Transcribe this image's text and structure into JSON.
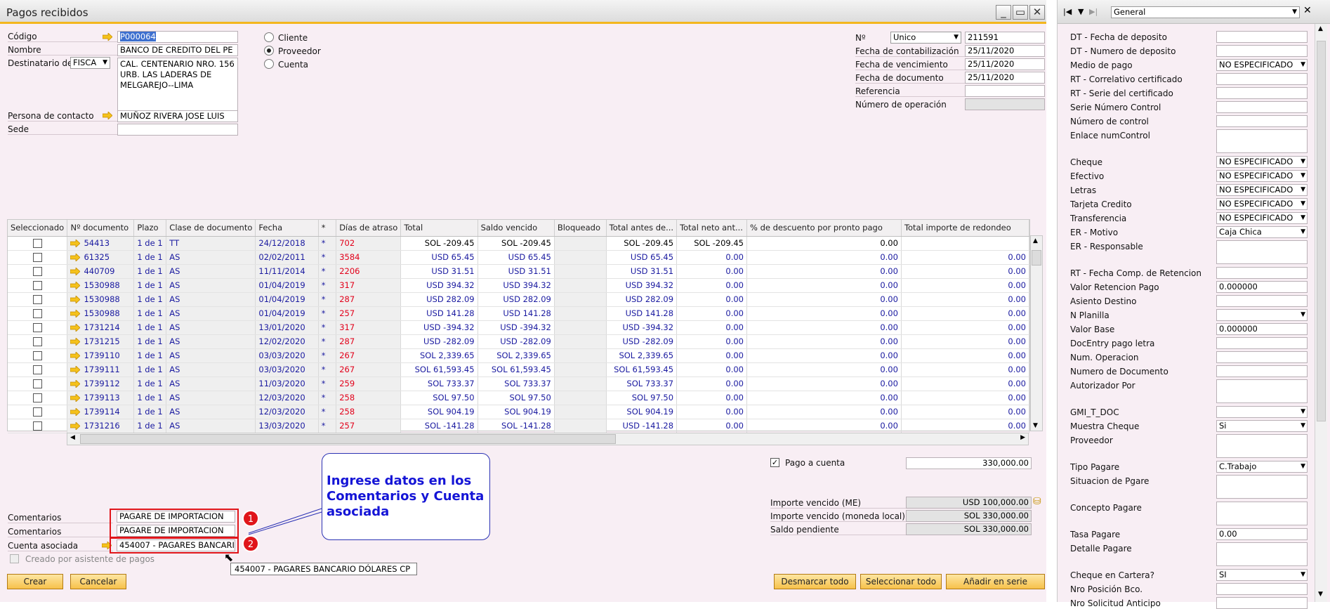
{
  "window": {
    "title": "Pagos recibidos"
  },
  "header": {
    "codigo_label": "Código",
    "codigo_value": "P000064",
    "nombre_label": "Nombre",
    "nombre_value": "BANCO DE CREDITO DEL PE",
    "destinatario_label": "Destinatario de f",
    "destinatario_select": "FISCA",
    "address_lines": [
      "CAL. CENTENARIO NRO. 156",
      "URB. LAS LADERAS DE",
      "MELGAREJO--LIMA"
    ],
    "persona_label": "Persona de contacto",
    "persona_value": "MUÑOZ RIVERA JOSE LUIS",
    "sede_label": "Sede",
    "radio_cliente": "Cliente",
    "radio_proveedor": "Proveedor",
    "radio_cuenta": "Cuenta",
    "no_label": "Nº",
    "no_select": "Unico",
    "no_value": "211591",
    "fecha_contab_label": "Fecha de contabilización",
    "fecha_contab_value": "25/11/2020",
    "fecha_venc_label": "Fecha de vencimiento",
    "fecha_venc_value": "25/11/2020",
    "fecha_doc_label": "Fecha de documento",
    "fecha_doc_value": "25/11/2020",
    "referencia_label": "Referencia",
    "num_oper_label": "Número de operación"
  },
  "grid": {
    "columns": [
      "Seleccionado",
      "Nº documento",
      "Plazo",
      "Clase de documento",
      "Fecha",
      "*",
      "Días de atraso",
      "Total",
      "Saldo vencido",
      "Bloqueado",
      "Total antes de...",
      "Total neto ant...",
      "% de descuento por pronto pago",
      "Total importe de redondeo"
    ],
    "rows": [
      {
        "doc": "54413",
        "plazo": "1 de 1",
        "clase": "TT",
        "fecha": "24/12/2018",
        "star": "*",
        "dias": "702",
        "total": "SOL -209.45",
        "saldo": "SOL -209.45",
        "antes": "SOL -209.45",
        "neto": "SOL -209.45",
        "desc": "0.00",
        "redondeo": ""
      },
      {
        "doc": "61325",
        "plazo": "1 de 1",
        "clase": "AS",
        "fecha": "02/02/2011",
        "star": "*",
        "dias": "3584",
        "total": "USD 65.45",
        "saldo": "USD 65.45",
        "antes": "USD 65.45",
        "neto": "0.00",
        "desc": "0.00",
        "redondeo": "0.00"
      },
      {
        "doc": "440709",
        "plazo": "1 de 1",
        "clase": "AS",
        "fecha": "11/11/2014",
        "star": "*",
        "dias": "2206",
        "total": "USD 31.51",
        "saldo": "USD 31.51",
        "antes": "USD 31.51",
        "neto": "0.00",
        "desc": "0.00",
        "redondeo": "0.00"
      },
      {
        "doc": "1530988",
        "plazo": "1 de 1",
        "clase": "AS",
        "fecha": "01/04/2019",
        "star": "*",
        "dias": "317",
        "total": "USD 394.32",
        "saldo": "USD 394.32",
        "antes": "USD 394.32",
        "neto": "0.00",
        "desc": "0.00",
        "redondeo": "0.00"
      },
      {
        "doc": "1530988",
        "plazo": "1 de 1",
        "clase": "AS",
        "fecha": "01/04/2019",
        "star": "*",
        "dias": "287",
        "total": "USD 282.09",
        "saldo": "USD 282.09",
        "antes": "USD 282.09",
        "neto": "0.00",
        "desc": "0.00",
        "redondeo": "0.00"
      },
      {
        "doc": "1530988",
        "plazo": "1 de 1",
        "clase": "AS",
        "fecha": "01/04/2019",
        "star": "*",
        "dias": "257",
        "total": "USD 141.28",
        "saldo": "USD 141.28",
        "antes": "USD 141.28",
        "neto": "0.00",
        "desc": "0.00",
        "redondeo": "0.00"
      },
      {
        "doc": "1731214",
        "plazo": "1 de 1",
        "clase": "AS",
        "fecha": "13/01/2020",
        "star": "*",
        "dias": "317",
        "total": "USD -394.32",
        "saldo": "USD -394.32",
        "antes": "USD -394.32",
        "neto": "0.00",
        "desc": "0.00",
        "redondeo": "0.00"
      },
      {
        "doc": "1731215",
        "plazo": "1 de 1",
        "clase": "AS",
        "fecha": "12/02/2020",
        "star": "*",
        "dias": "287",
        "total": "USD -282.09",
        "saldo": "USD -282.09",
        "antes": "USD -282.09",
        "neto": "0.00",
        "desc": "0.00",
        "redondeo": "0.00"
      },
      {
        "doc": "1739110",
        "plazo": "1 de 1",
        "clase": "AS",
        "fecha": "03/03/2020",
        "star": "*",
        "dias": "267",
        "total": "SOL 2,339.65",
        "saldo": "SOL 2,339.65",
        "antes": "SOL 2,339.65",
        "neto": "0.00",
        "desc": "0.00",
        "redondeo": "0.00"
      },
      {
        "doc": "1739111",
        "plazo": "1 de 1",
        "clase": "AS",
        "fecha": "03/03/2020",
        "star": "*",
        "dias": "267",
        "total": "SOL 61,593.45",
        "saldo": "SOL 61,593.45",
        "antes": "SOL 61,593.45",
        "neto": "0.00",
        "desc": "0.00",
        "redondeo": "0.00"
      },
      {
        "doc": "1739112",
        "plazo": "1 de 1",
        "clase": "AS",
        "fecha": "11/03/2020",
        "star": "*",
        "dias": "259",
        "total": "SOL 733.37",
        "saldo": "SOL 733.37",
        "antes": "SOL 733.37",
        "neto": "0.00",
        "desc": "0.00",
        "redondeo": "0.00"
      },
      {
        "doc": "1739113",
        "plazo": "1 de 1",
        "clase": "AS",
        "fecha": "12/03/2020",
        "star": "*",
        "dias": "258",
        "total": "SOL 97.50",
        "saldo": "SOL 97.50",
        "antes": "SOL 97.50",
        "neto": "0.00",
        "desc": "0.00",
        "redondeo": "0.00"
      },
      {
        "doc": "1739114",
        "plazo": "1 de 1",
        "clase": "AS",
        "fecha": "12/03/2020",
        "star": "*",
        "dias": "258",
        "total": "SOL 904.19",
        "saldo": "SOL 904.19",
        "antes": "SOL 904.19",
        "neto": "0.00",
        "desc": "0.00",
        "redondeo": "0.00"
      },
      {
        "doc": "1731216",
        "plazo": "1 de 1",
        "clase": "AS",
        "fecha": "13/03/2020",
        "star": "*",
        "dias": "257",
        "total": "SOL -141.28",
        "saldo": "SOL -141.28",
        "antes": "USD -141.28",
        "neto": "0.00",
        "desc": "0.00",
        "redondeo": "0.00"
      }
    ]
  },
  "footer": {
    "pago_cuenta_label": "Pago a cuenta",
    "pago_cuenta_value": "330,000.00",
    "importe_me_label": "Importe vencido (ME)",
    "importe_me_value": "USD 100,000.00",
    "importe_ml_label": "Importe vencido (moneda local)",
    "importe_ml_value": "SOL 330,000.00",
    "saldo_label": "Saldo pendiente",
    "saldo_value": "SOL 330,000.00",
    "comentarios_label": "Comentarios",
    "comentarios1_value": "PAGARE DE IMPORTACION",
    "comentarios2_value": "PAGARE DE IMPORTACION",
    "cuenta_label": "Cuenta asociada",
    "cuenta_value": "454007 - PAGARES BANCARI",
    "asistente_label": "Creado por asistente de pagos",
    "tooltip": "454007 - PAGARES BANCARIO DÓLARES CP",
    "callout": "Ingrese datos en los Comentarios y Cuenta asociada",
    "badge1": "1",
    "badge2": "2",
    "btn_crear": "Crear",
    "btn_cancelar": "Cancelar",
    "btn_desmarcar": "Desmarcar todo",
    "btn_seleccionar": "Seleccionar todo",
    "btn_anadir": "Añadir en serie"
  },
  "udf": {
    "select": "General",
    "fields": [
      {
        "label": "DT - Fecha de deposito",
        "value": "",
        "type": "text"
      },
      {
        "label": "DT - Numero de deposito",
        "value": "",
        "type": "text"
      },
      {
        "label": "Medio de pago",
        "value": "NO ESPECIFICADO",
        "type": "select"
      },
      {
        "label": "RT - Correlativo certificado",
        "value": "",
        "type": "text"
      },
      {
        "label": "RT - Serie del certificado",
        "value": "",
        "type": "text"
      },
      {
        "label": "Serie Número Control",
        "value": "",
        "type": "text"
      },
      {
        "label": "Número de control",
        "value": "",
        "type": "text"
      },
      {
        "label": "Enlace numControl",
        "value": "",
        "type": "tall"
      },
      {
        "label": "Cheque",
        "value": "NO ESPECIFICADO",
        "type": "select"
      },
      {
        "label": "Efectivo",
        "value": "NO ESPECIFICADO",
        "type": "select"
      },
      {
        "label": "Letras",
        "value": "NO ESPECIFICADO",
        "type": "select"
      },
      {
        "label": "Tarjeta Credito",
        "value": "NO ESPECIFICADO",
        "type": "select"
      },
      {
        "label": "Transferencia",
        "value": "NO ESPECIFICADO",
        "type": "select"
      },
      {
        "label": "ER - Motivo",
        "value": "Caja Chica",
        "type": "select"
      },
      {
        "label": "ER - Responsable",
        "value": "",
        "type": "tall"
      },
      {
        "label": "RT - Fecha Comp. de Retencion",
        "value": "",
        "type": "text"
      },
      {
        "label": "Valor Retencion Pago",
        "value": "0.000000",
        "type": "text"
      },
      {
        "label": "Asiento Destino",
        "value": "",
        "type": "text"
      },
      {
        "label": "N Planilla",
        "value": "",
        "type": "select"
      },
      {
        "label": "Valor Base",
        "value": "0.000000",
        "type": "text"
      },
      {
        "label": "DocEntry pago letra",
        "value": "",
        "type": "text"
      },
      {
        "label": "Num. Operacion",
        "value": "",
        "type": "text"
      },
      {
        "label": "Numero de Documento",
        "value": "",
        "type": "text"
      },
      {
        "label": "Autorizador Por",
        "value": "",
        "type": "tall"
      },
      {
        "label": "GMI_T_DOC",
        "value": "",
        "type": "select"
      },
      {
        "label": "Muestra Cheque",
        "value": "Si",
        "type": "select"
      },
      {
        "label": "Proveedor",
        "value": "",
        "type": "tall"
      },
      {
        "label": "Tipo Pagare",
        "value": "C.Trabajo",
        "type": "select"
      },
      {
        "label": "Situacion de Pgare",
        "value": "",
        "type": "tall"
      },
      {
        "label": "Concepto Pagare",
        "value": "",
        "type": "tall"
      },
      {
        "label": "Tasa Pagare",
        "value": "0.00",
        "type": "text"
      },
      {
        "label": "Detalle Pagare",
        "value": "",
        "type": "tall"
      },
      {
        "label": "Cheque en Cartera?",
        "value": "SI",
        "type": "select"
      },
      {
        "label": "Nro Posición Bco.",
        "value": "",
        "type": "text"
      },
      {
        "label": "Nro Solicitud Anticipo",
        "value": "",
        "type": "text"
      }
    ]
  }
}
